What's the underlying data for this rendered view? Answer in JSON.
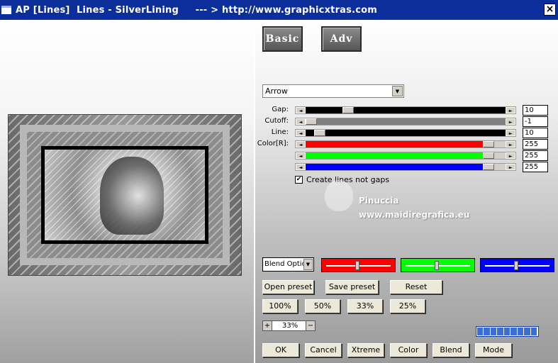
{
  "window": {
    "title": "AP [Lines]  Lines - SilverLining     --- > http://www.graphicxtras.com",
    "close_label": "×"
  },
  "tabs": {
    "basic": "Basic",
    "adv": "Adv"
  },
  "mode_select": {
    "value": "Arrow"
  },
  "sliders": [
    {
      "label": "Gap:",
      "value": "10",
      "color": "#000000"
    },
    {
      "label": "Cutoff:",
      "value": "-1",
      "color": "#808080"
    },
    {
      "label": "Line:",
      "value": "10",
      "color": "#000000"
    },
    {
      "label": "Color[R]:",
      "value": "255",
      "color": "#ff0000"
    },
    {
      "label": "",
      "value": "255",
      "color": "#00ff00"
    },
    {
      "label": "",
      "value": "255",
      "color": "#0000ff"
    }
  ],
  "create_lines": {
    "label": "Create lines not gaps",
    "checked": true,
    "check_glyph": "✔"
  },
  "watermark": {
    "name": "Pinuccia",
    "url": "www.maidiregrafica.eu"
  },
  "blend": {
    "select_value": "Blend Optio",
    "color_sliders": [
      {
        "color": "#ff0000"
      },
      {
        "color": "#00ff00"
      },
      {
        "color": "#0000ff"
      }
    ]
  },
  "buttons": {
    "open_preset": "Open preset",
    "save_preset": "Save preset",
    "reset": "Reset",
    "zoom_100": "100%",
    "zoom_50": "50%",
    "zoom_33": "33%",
    "zoom_25": "25%",
    "ok": "OK",
    "cancel": "Cancel",
    "xtreme": "Xtreme",
    "color": "Color",
    "blend": "Blend",
    "mode": "Mode"
  },
  "zoom": {
    "value": "33%",
    "plus": "+",
    "minus": "−"
  },
  "progress": {
    "segments": 9
  },
  "icons": {
    "dropdown_arrow": "▼",
    "left_arrow": "◄",
    "right_arrow": "►"
  }
}
